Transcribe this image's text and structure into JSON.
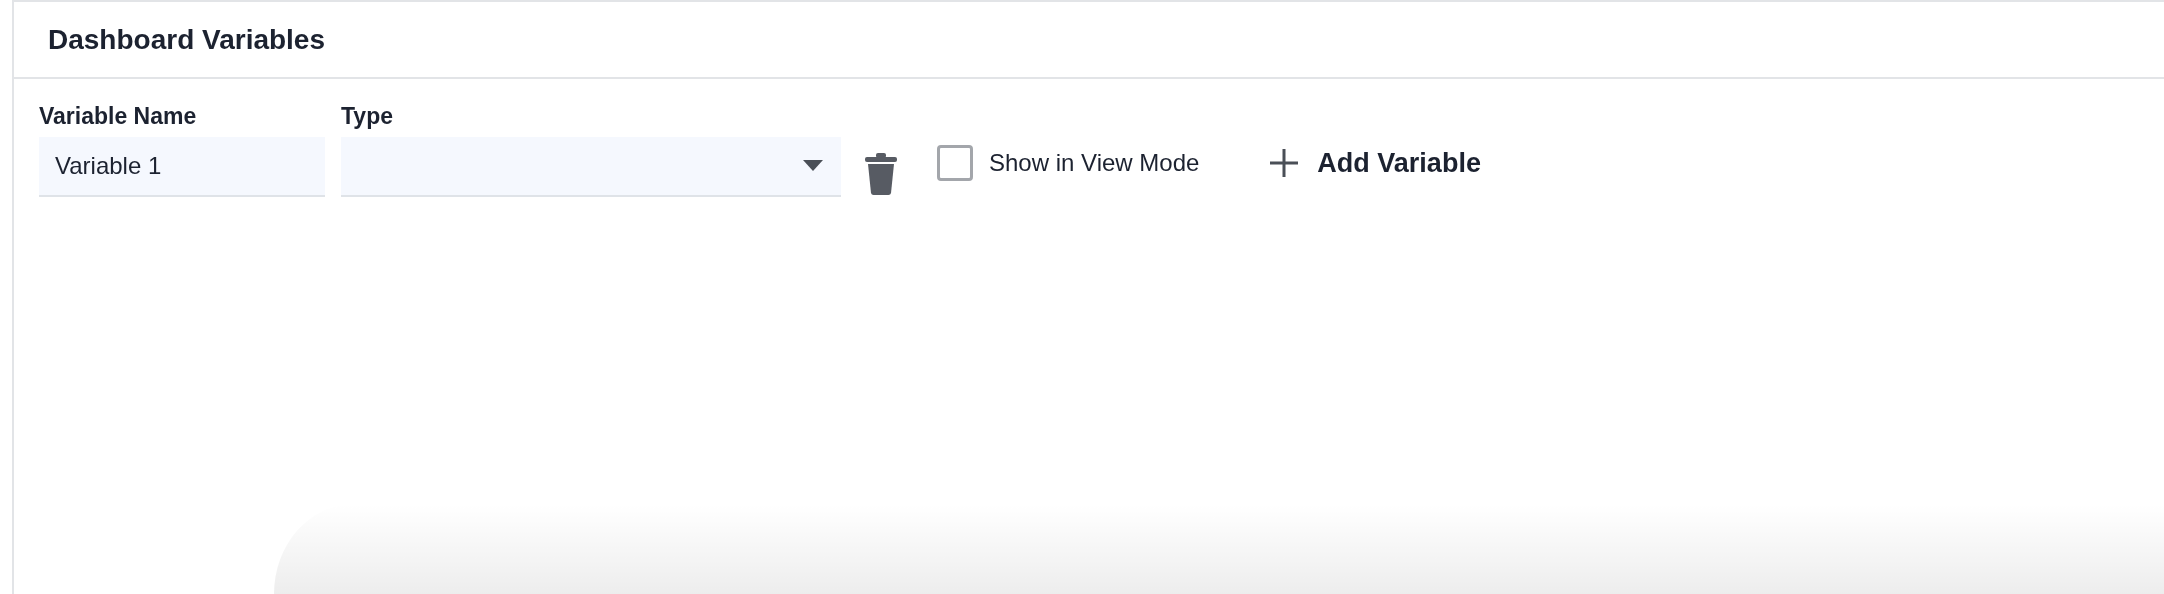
{
  "panel": {
    "title": "Dashboard Variables"
  },
  "variables": [
    {
      "name_label": "Variable Name",
      "name_value": "Variable 1",
      "type_label": "Type",
      "show_in_view_mode": {
        "label": "Show in View Mode",
        "checked": false
      }
    }
  ],
  "add_button": {
    "label": "Add Variable"
  }
}
